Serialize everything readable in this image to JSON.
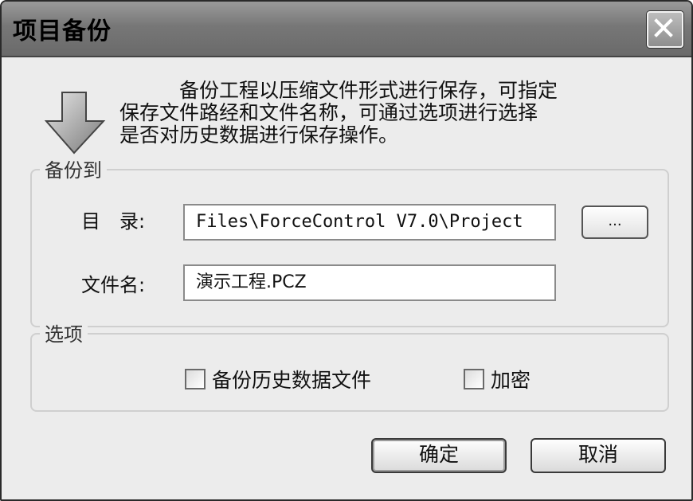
{
  "window": {
    "title": "项目备份"
  },
  "description": "　　　备份工程以压缩文件形式进行保存，可指定\n保存文件路经和文件名称，可通过选项进行选择\n是否对历史数据进行保存操作。",
  "backup_group": {
    "legend": "备份到",
    "dir_label": "目　录:",
    "dir_value": "Files\\ForceControl V7.0\\Project",
    "browse_label": "...",
    "file_label": "文件名:",
    "file_value": "演示工程.PCZ"
  },
  "options_group": {
    "legend": "选项",
    "checkbox_history": {
      "label": "备份历史数据文件",
      "checked": false
    },
    "checkbox_encrypt": {
      "label": "加密",
      "checked": false
    }
  },
  "buttons": {
    "ok": "确定",
    "cancel": "取消"
  },
  "icons": {
    "close": "close-icon",
    "arrow": "arrow-down-icon"
  }
}
